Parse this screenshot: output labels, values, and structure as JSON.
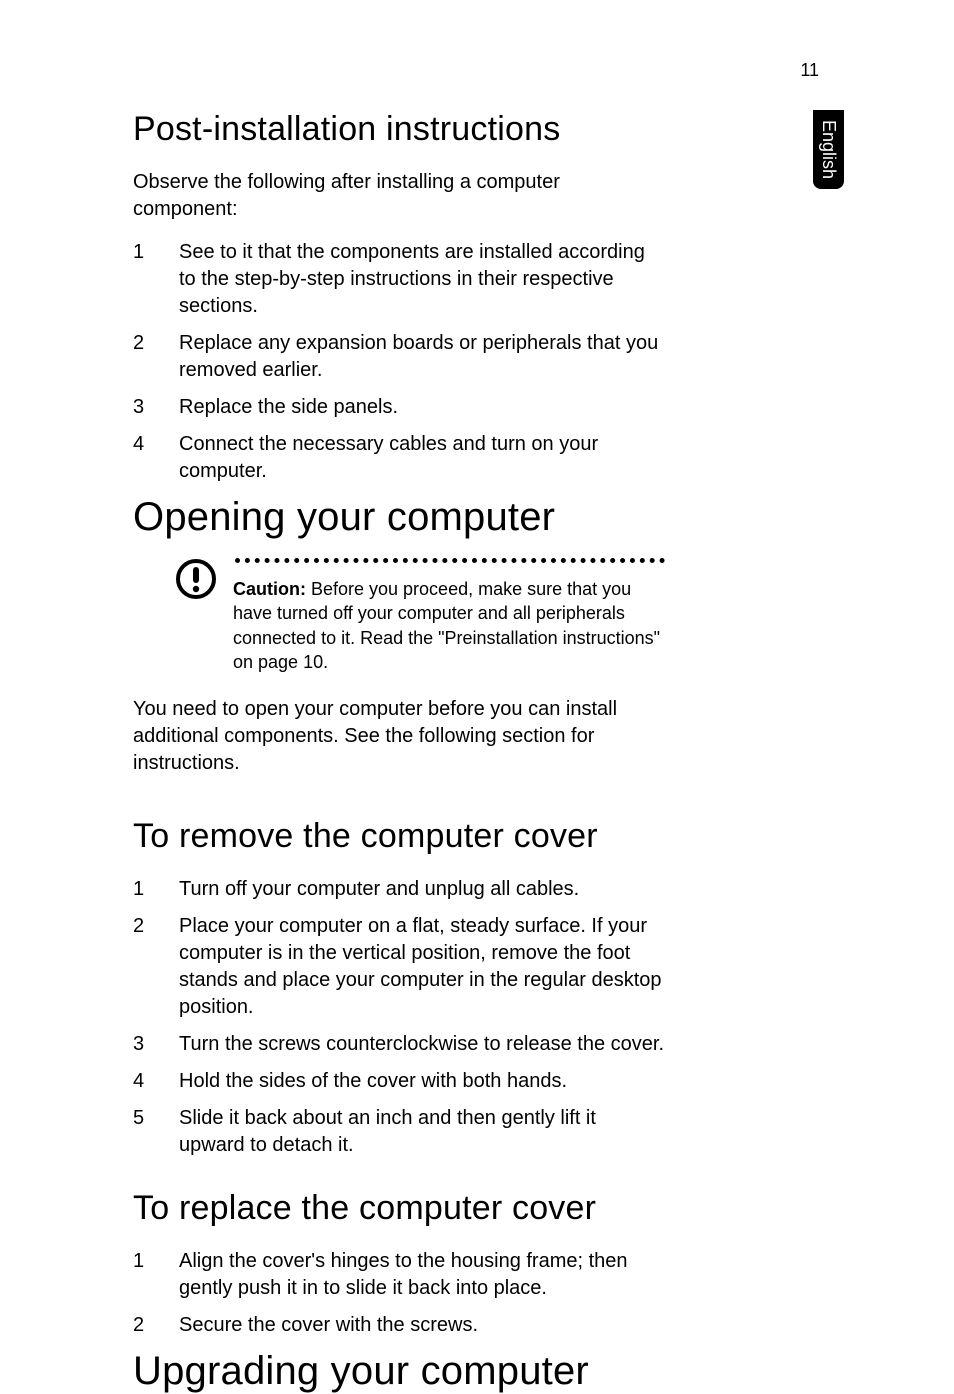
{
  "page_number": "11",
  "side_tab": "English",
  "section1": {
    "heading": "Post-installation instructions",
    "intro": "Observe the following after installing a computer component:",
    "items": [
      "See to it that the components are installed according to the step-by-step instructions in their respective sections.",
      "Replace any expansion boards or peripherals that you removed earlier.",
      "Replace the side panels.",
      "Connect the necessary cables and turn on your computer."
    ]
  },
  "section2": {
    "heading": "Opening your computer",
    "caution_label": "Caution:",
    "caution_body": " Before you proceed, make sure that you have turned off your computer and all peripherals connected to it. Read the \"Preinstallation instructions\" on page 10.",
    "intro": "You need to open your computer before you can install additional components.  See the following section for instructions."
  },
  "section3": {
    "heading": "To remove the computer cover",
    "items": [
      "Turn off your computer and unplug all cables.",
      "Place your computer on a flat, steady surface. If your computer is in the vertical position, remove the foot stands and place your computer in the regular desktop position.",
      "Turn the screws counterclockwise to release the cover.",
      "Hold the sides of the cover with both hands.",
      "Slide it back about an inch and then gently lift it upward to detach it."
    ]
  },
  "section4": {
    "heading": "To replace the computer cover",
    "items": [
      "Align the cover's hinges to the housing frame; then gently push it in to slide it back into place.",
      "Secure the cover with the screws."
    ]
  },
  "section5": {
    "heading": "Upgrading your computer"
  }
}
